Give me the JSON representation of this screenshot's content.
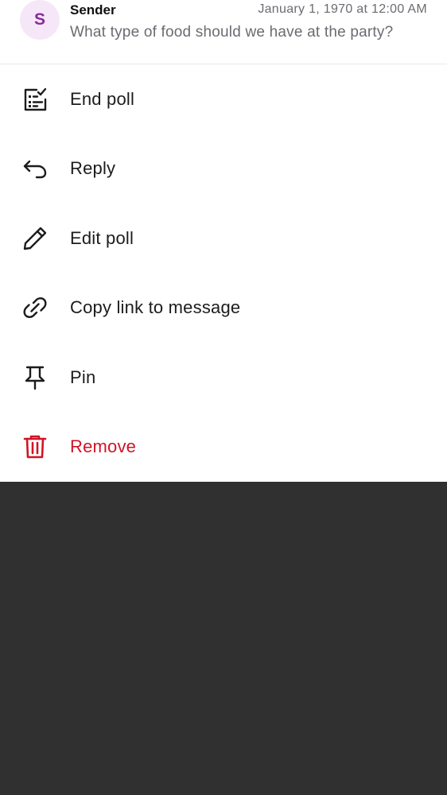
{
  "message": {
    "avatar_initial": "S",
    "sender": "Sender",
    "timestamp": "January 1, 1970 at 12:00 AM",
    "preview": "What type of food should we have at the party?"
  },
  "menu": {
    "items": [
      {
        "label": "End poll",
        "icon": "poll-icon"
      },
      {
        "label": "Reply",
        "icon": "reply-icon"
      },
      {
        "label": "Edit poll",
        "icon": "pencil-icon"
      },
      {
        "label": "Copy link to message",
        "icon": "link-icon"
      },
      {
        "label": "Pin",
        "icon": "pin-icon"
      },
      {
        "label": "Remove",
        "icon": "trash-icon"
      }
    ]
  },
  "colors": {
    "danger": "#d01426",
    "avatar_bg": "#f6e7f8",
    "avatar_text": "#8a2a9a",
    "backdrop": "#303030"
  }
}
